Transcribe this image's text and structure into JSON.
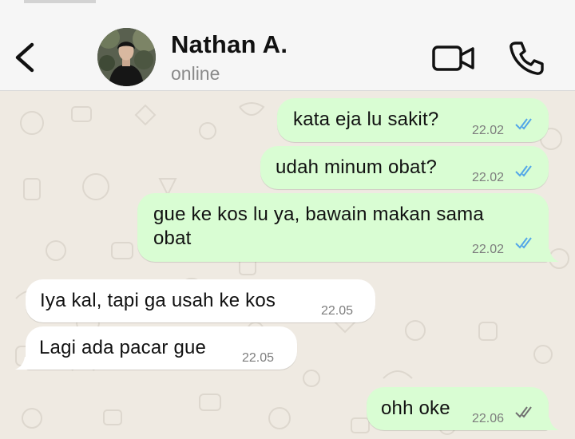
{
  "header": {
    "contact_name": "Nathan A.",
    "contact_status": "online",
    "icons": {
      "back": "chevron-left-icon",
      "video": "video-camera-icon",
      "call": "phone-icon"
    }
  },
  "colors": {
    "outgoing_bubble": "#d9fdd3",
    "incoming_bubble": "#ffffff",
    "chat_background": "#efeae2",
    "read_ticks": "#53a6e8",
    "delivered_ticks": "#707070"
  },
  "messages": [
    {
      "direction": "outgoing",
      "text": "kata eja lu sakit?",
      "time": "22.02",
      "status": "read"
    },
    {
      "direction": "outgoing",
      "text": "udah minum obat?",
      "time": "22.02",
      "status": "read"
    },
    {
      "direction": "outgoing",
      "text_line1": "gue ke kos lu ya, bawain makan sama",
      "text_line2": "obat",
      "time": "22.02",
      "status": "read"
    },
    {
      "direction": "incoming",
      "text": "Iya kal, tapi ga usah ke kos",
      "time": "22.05"
    },
    {
      "direction": "incoming",
      "text": "Lagi ada pacar gue",
      "time": "22.05"
    },
    {
      "direction": "outgoing",
      "text": "ohh oke",
      "time": "22.06",
      "status": "delivered"
    }
  ]
}
